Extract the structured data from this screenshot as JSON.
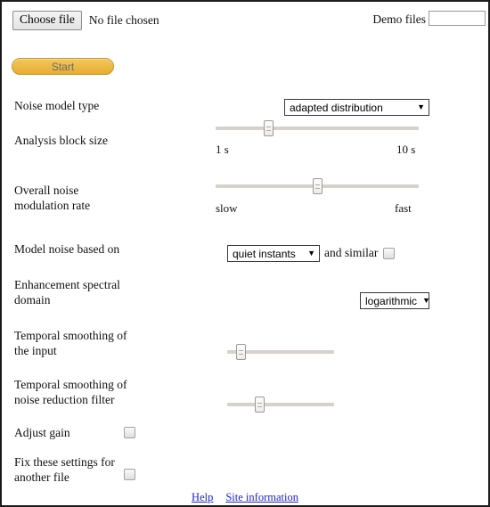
{
  "file_picker": {
    "button_label": "Choose file",
    "status_text": "No file chosen"
  },
  "demo_files": {
    "label": "Demo files",
    "value": "",
    "placeholder": ""
  },
  "start": {
    "label": "Start"
  },
  "rows": {
    "noise_model_type": {
      "label": "Noise model type",
      "select_value": "adapted distribution",
      "select_arrow": "▼"
    },
    "analysis_block_size": {
      "label": "Analysis block size",
      "min_tick": "1 s",
      "max_tick": "10 s",
      "value_percent": 25
    },
    "overall_noise_modulation_rate": {
      "label": "Overall noise\nmodulation rate",
      "line1": "Overall noise",
      "line2": "modulation rate",
      "min_tick": "slow",
      "max_tick": "fast",
      "value_percent": 50
    },
    "model_noise_based_on": {
      "label": "Model noise based on",
      "select_value": "quiet instants",
      "select_arrow": "▼",
      "and_similar_label": "and similar",
      "and_similar_checked": false
    },
    "enhancement_spectral_domain": {
      "line1": "Enhancement spectral",
      "line2": "domain",
      "select_value": "logarithmic",
      "select_arrow": "▼"
    },
    "temporal_smoothing_input": {
      "line1": "Temporal smoothing of",
      "line2": "the input",
      "value_percent": 9
    },
    "temporal_smoothing_filter": {
      "line1": "Temporal smoothing of",
      "line2": "noise reduction filter",
      "value_percent": 28
    },
    "adjust_gain": {
      "label": "Adjust gain",
      "checked": false
    },
    "fix_settings": {
      "line1": "Fix these settings for",
      "line2": "another file",
      "checked": false
    }
  },
  "footer": {
    "help_label": "Help",
    "site_info_label": "Site information"
  },
  "colors": {
    "start_button": "#e7ad31",
    "link": "#1f24c4",
    "slider_track": "#d6d2cb"
  }
}
